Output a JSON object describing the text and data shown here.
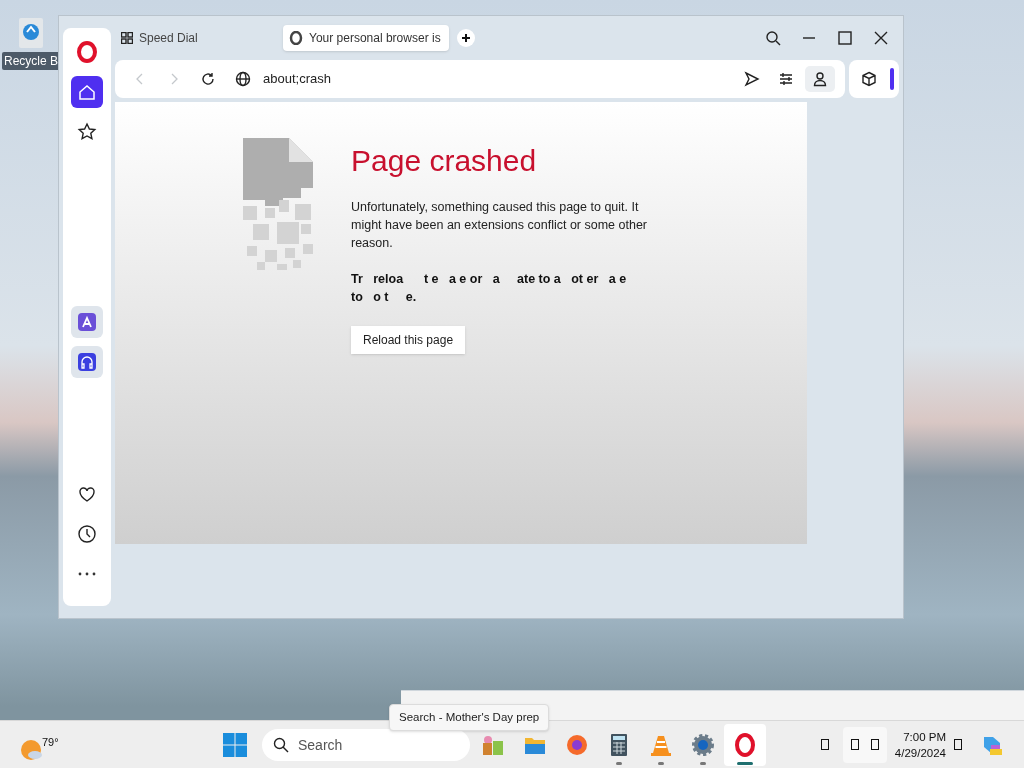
{
  "desktop_icons": [
    {
      "label": "Recycle B"
    }
  ],
  "browser": {
    "sidebar": {
      "top": [
        {
          "kind": "opera",
          "selected": false
        },
        {
          "kind": "home",
          "selected": true
        },
        {
          "kind": "star",
          "selected": false
        }
      ],
      "apps": [
        {
          "kind": "aria"
        },
        {
          "kind": "music"
        }
      ],
      "bottom": [
        {
          "kind": "heart"
        },
        {
          "kind": "clock"
        },
        {
          "kind": "more"
        }
      ]
    },
    "tabs": [
      {
        "label": "Speed Dial",
        "kind": "speed-dial",
        "selected": false
      },
      {
        "label": "Your personal browser is",
        "kind": "page",
        "selected": true
      }
    ],
    "address": "about;crash",
    "page": {
      "title": "Page crashed",
      "message": "Unfortunately, something caused this page to quit. It might have been an extensions conflict or some other reason.",
      "hint": "Tr   reloa      t e   a e or   a     ate to a   ot er   a e   to   o t     e.",
      "button": "Reload this page"
    }
  },
  "tooltip": "Search - Mother's Day prep",
  "taskbar": {
    "weather": "79°",
    "search_placeholder": "Search",
    "apps": [
      {
        "kind": "gifts",
        "running": false,
        "active": false
      },
      {
        "kind": "files",
        "running": false,
        "active": false
      },
      {
        "kind": "firefox",
        "running": false,
        "active": false
      },
      {
        "kind": "calculator",
        "running": true,
        "active": false
      },
      {
        "kind": "vlc",
        "running": true,
        "active": false
      },
      {
        "kind": "settings",
        "running": true,
        "active": false
      },
      {
        "kind": "opera",
        "running": true,
        "active": true
      }
    ],
    "time": "7:00 PM",
    "date": "4/29/2024"
  }
}
